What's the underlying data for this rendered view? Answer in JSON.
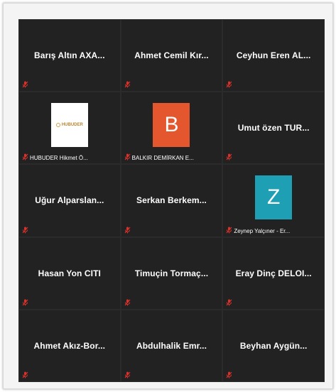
{
  "colors": {
    "tile_bg": "#222222",
    "grid_gap": "#2b2b2b",
    "mute_red": "#d9312b",
    "avatar_orange": "#e4572e",
    "avatar_teal": "#1f9fb4",
    "logo_gold": "#b8862f"
  },
  "participants": [
    {
      "name": "Barış Altın AXA...",
      "type": "name"
    },
    {
      "name": "Ahmet Cemil Kır...",
      "type": "name"
    },
    {
      "name": "Ceyhun Eren AL...",
      "type": "name"
    },
    {
      "label": "HUBUDER Hikmet Ö...",
      "type": "logo",
      "logo_text": "HUBUDER"
    },
    {
      "label": "BALKIR DEMİRKAN E...",
      "type": "avatar",
      "initial": "B"
    },
    {
      "name": "Umut özen TUR...",
      "type": "name"
    },
    {
      "name": "Uğur Alparslan...",
      "type": "name"
    },
    {
      "name": "Serkan Berkem...",
      "type": "name"
    },
    {
      "label": "Zeynep Yalçıner - Er...",
      "type": "avatar",
      "initial": "Z"
    },
    {
      "name": "Hasan Yon CITI",
      "type": "name"
    },
    {
      "name": "Timuçin Tormaç...",
      "type": "name"
    },
    {
      "name": "Eray Dinç DELOI...",
      "type": "name"
    },
    {
      "name": "Ahmet Akız-Bor...",
      "type": "name"
    },
    {
      "name": "Abdulhalik Emr...",
      "type": "name"
    },
    {
      "name": "Beyhan Aygün...",
      "type": "name"
    }
  ]
}
